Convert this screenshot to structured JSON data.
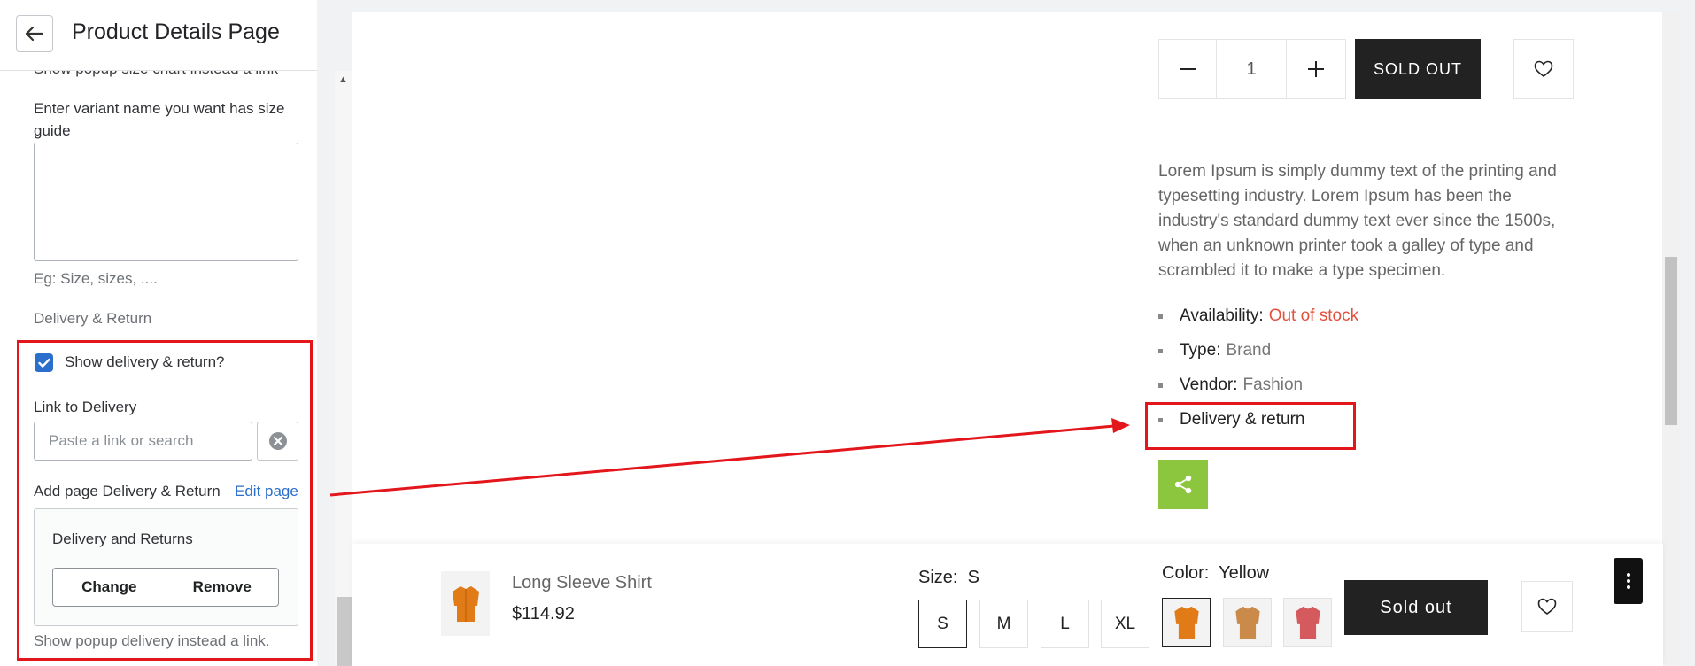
{
  "panel": {
    "title": "Product Details Page",
    "cut_text": "Show popup size chart instead a link",
    "variant_label": "Enter variant name you want has size guide",
    "variant_hint": "Eg: Size, sizes, ....",
    "section_heading": "Delivery & Return",
    "show_delivery_label": "Show delivery & return?",
    "link_label": "Link to Delivery",
    "link_placeholder": "Paste a link or search",
    "add_page_label": "Add page Delivery & Return",
    "edit_page_link": "Edit page",
    "page_card_title": "Delivery and Returns",
    "change_button": "Change",
    "remove_button": "Remove",
    "popup_hint": "Show popup delivery instead a link."
  },
  "product": {
    "quantity": "1",
    "sold_out_button": "SOLD OUT",
    "description": "Lorem Ipsum is simply dummy text of the printing and typesetting industry. Lorem Ipsum has been the industry's standard dummy text ever since the 1500s, when an unknown printer took a galley of type and scrambled it to make a type specimen.",
    "availability_label": "Availability:",
    "availability_value": "Out of stock",
    "type_label": "Type:",
    "type_value": "Brand",
    "vendor_label": "Vendor:",
    "vendor_value": "Fashion",
    "delivery_link": "Delivery & return"
  },
  "sticky": {
    "name": "Long Sleeve Shirt",
    "price": "$114.92",
    "size_label": "Size:",
    "size_value": "S",
    "sizes": [
      "S",
      "M",
      "L",
      "XL"
    ],
    "color_label": "Color:",
    "color_value": "Yellow",
    "sold_out_button": "Sold out"
  },
  "colors": {
    "accent_red": "#e3161c",
    "share_green": "#8cc63f",
    "checkbox_blue": "#2c6ecb",
    "out_of_stock": "#e3513d",
    "shirt_colors": [
      "#e07b17",
      "#c98a4a",
      "#d45a5e"
    ]
  },
  "icons": [
    "back-arrow-icon",
    "checkmark-icon",
    "clear-icon",
    "minus-icon",
    "plus-icon",
    "heart-icon",
    "share-icon",
    "kebab-menu-icon"
  ]
}
